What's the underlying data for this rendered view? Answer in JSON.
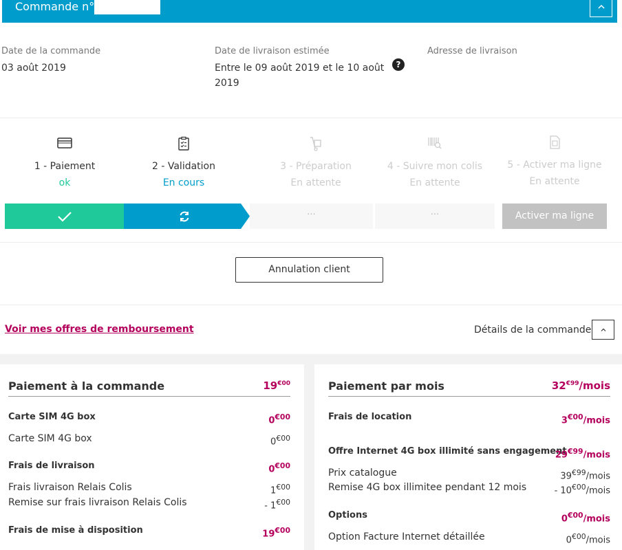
{
  "header": {
    "title": "Commande n°",
    "collapse_icon": "chevron-up-icon"
  },
  "order_info": {
    "order_date_label": "Date de la commande",
    "order_date": "03 août 2019",
    "delivery_label": "Date de livraison estimée",
    "delivery_line1": "Entre le 09 août 2019 et le 10 août",
    "delivery_line2": "2019",
    "address_label": "Adresse de livraison",
    "help": "?"
  },
  "steps": [
    {
      "name": "1 - Paiement",
      "status": "ok",
      "icon": "credit-card-icon"
    },
    {
      "name": "2 - Validation",
      "status": "En cours",
      "icon": "clipboard-check-icon"
    },
    {
      "name": "3 - Préparation",
      "status": "En attente",
      "icon": "dolly-icon"
    },
    {
      "name": "4 - Suivre mon colis",
      "status": "En attente",
      "icon": "barcode-search-icon"
    },
    {
      "name": "5 - Activer ma ligne",
      "status": "En attente",
      "icon": "sim-card-icon"
    }
  ],
  "progress": {
    "wait1": "···",
    "wait2": "···",
    "activate_label": "Activer ma ligne"
  },
  "cancel_label": "Annulation client",
  "refund_link": "Voir mes offres de remboursement",
  "details_label": "Détails de la commande",
  "left_panel": {
    "title": "Paiement à la commande",
    "total": "19",
    "total_sup": "€00",
    "rows": [
      {
        "label": "Carte SIM 4G box",
        "amount": "0",
        "sup": "€00"
      },
      {
        "label": "Carte SIM 4G box",
        "amount": "0",
        "sup": "€00"
      },
      {
        "label": "Frais de livraison",
        "amount": "0",
        "sup": "€00"
      },
      {
        "label": "Frais livraison Relais Colis",
        "amount": "1",
        "sup": "€00"
      },
      {
        "label": "Remise sur frais livraison Relais Colis",
        "amount": "- 1",
        "sup": "€00"
      },
      {
        "label": "Frais de mise à disposition",
        "amount": "19",
        "sup": "€00"
      }
    ]
  },
  "right_panel": {
    "title": "Paiement par mois",
    "total": "32",
    "total_sup": "€99",
    "total_unit": "/mois",
    "rows": [
      {
        "label": "Frais de location",
        "amount": "3",
        "sup": "€00",
        "unit": "/mois"
      },
      {
        "label": "Offre Internet 4G box illimité sans engagement",
        "amount": "29",
        "sup": "€99",
        "unit": "/mois"
      },
      {
        "label": "Prix catalogue",
        "amount": "39",
        "sup": "€99",
        "unit": "/mois"
      },
      {
        "label": "Remise 4G box illimitee pendant 12 mois",
        "amount": "- 10",
        "sup": "€00",
        "unit": "/mois"
      },
      {
        "label": "Options",
        "amount": "0",
        "sup": "€00",
        "unit": "/mois"
      },
      {
        "label": "Option Facture Internet détaillée",
        "amount": "0",
        "sup": "€00",
        "unit": "/mois"
      }
    ]
  },
  "colors": {
    "brand_blue": "#009dcc",
    "ok_green": "#1fc99a",
    "accent_pink": "#b4005c"
  }
}
